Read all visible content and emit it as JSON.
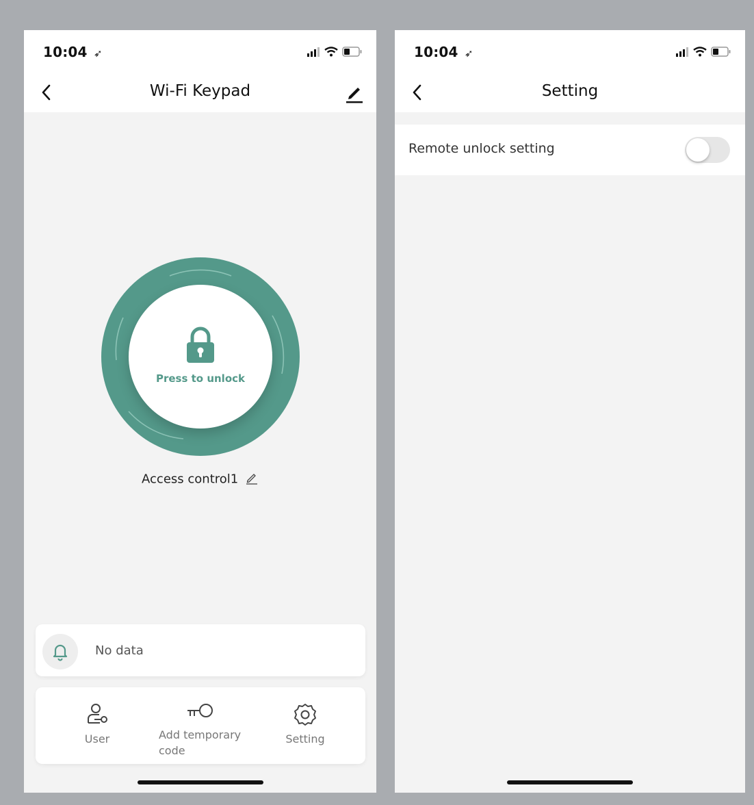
{
  "left_screen": {
    "status_bar": {
      "time": "10:04",
      "location_icon": "location-arrow-icon"
    },
    "header": {
      "title": "Wi-Fi Keypad"
    },
    "lock_button": {
      "label": "Press to unlock",
      "icon": "padlock-icon"
    },
    "device_name": "Access control1",
    "notification": {
      "text": "No data",
      "icon": "bell-icon"
    },
    "actions": [
      {
        "label": "User",
        "icon": "user-key-icon"
      },
      {
        "label": "Add temporary code",
        "icon": "key-icon"
      },
      {
        "label": "Setting",
        "icon": "gear-icon"
      }
    ]
  },
  "right_screen": {
    "status_bar": {
      "time": "10:04"
    },
    "header": {
      "title": "Setting"
    },
    "settings": [
      {
        "label": "Remote unlock setting",
        "enabled": false
      }
    ]
  },
  "colors": {
    "accent": "#54998a",
    "background": "#f3f3f3",
    "frame": "#a9acb0"
  }
}
